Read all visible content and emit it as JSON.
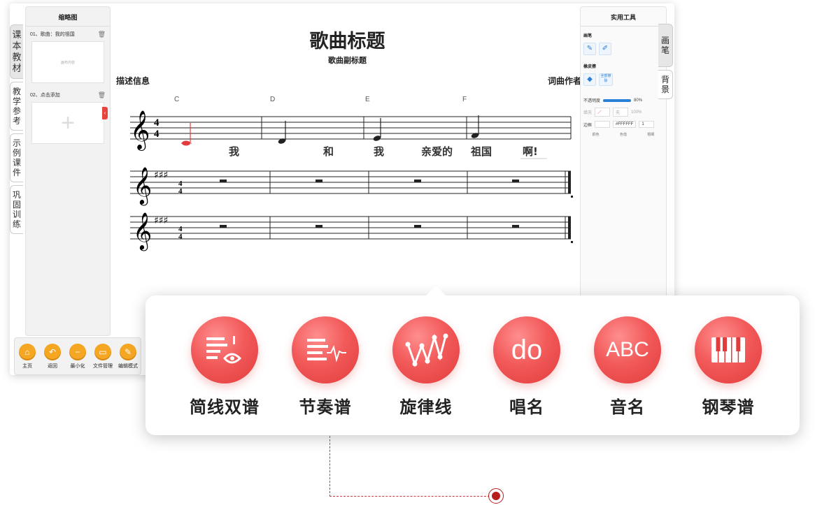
{
  "left_tabs": [
    "课本教材",
    "教学参考",
    "示例课件",
    "巩固训练"
  ],
  "thumbnails": {
    "title": "缩略图",
    "items": [
      {
        "label": "01、歌曲：我的祖国",
        "content": "画布内容"
      },
      {
        "label": "02、点击添加",
        "content": "+"
      }
    ]
  },
  "toolbar": [
    {
      "label": "主页",
      "icon": "home-icon"
    },
    {
      "label": "返回",
      "icon": "back-icon"
    },
    {
      "label": "最小化",
      "icon": "minimize-icon"
    },
    {
      "label": "文件管理",
      "icon": "folder-icon"
    },
    {
      "label": "编辑模式",
      "icon": "edit-icon"
    }
  ],
  "score": {
    "title": "歌曲标题",
    "subtitle": "歌曲副标题",
    "description": "描述信息",
    "author": "词曲作者",
    "chords": [
      "C",
      "D",
      "E",
      "F"
    ],
    "time_signature": "4/4",
    "lyrics": [
      "我",
      "和",
      "我",
      "亲爱的",
      "祖国",
      "啊!"
    ]
  },
  "tools": {
    "title": "实用工具",
    "pen_label": "画笔",
    "eraser_label": "橡皮擦",
    "clear_all": "全部擦除",
    "opacity_label": "不透明度",
    "opacity_value": "80%",
    "fill_label": "填充",
    "fill_value": "无",
    "fill_percent": "100%",
    "border_label": "边框",
    "border_color": "#FFFFFF",
    "border_width": "1",
    "col_color": "颜色",
    "col_value": "色值",
    "col_width": "粗细"
  },
  "right_tabs": [
    "画笔",
    "背景"
  ],
  "features": [
    {
      "label": "简线双谱"
    },
    {
      "label": "节奏谱"
    },
    {
      "label": "旋律线"
    },
    {
      "label": "唱名",
      "glyph": "do"
    },
    {
      "label": "音名",
      "glyph": "ABC"
    },
    {
      "label": "钢琴谱"
    }
  ],
  "colors": {
    "accent": "#e23b3b",
    "toolbar_icon": "#f5a623",
    "pen_blue": "#2a7fd4"
  }
}
